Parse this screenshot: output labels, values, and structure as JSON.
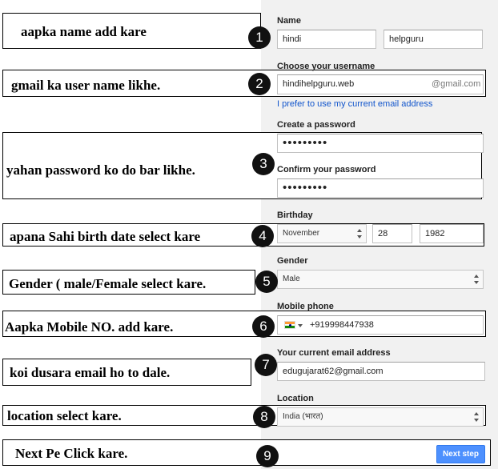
{
  "form": {
    "name_label": "Name",
    "first_name": "hindi",
    "last_name": "helpguru",
    "username_label": "Choose your username",
    "username_value": "hindihelpguru.web",
    "username_suffix": "@gmail.com",
    "use_current_email_link": "I prefer to use my current email address",
    "create_password_label": "Create a password",
    "password_mask": "•••••••••",
    "confirm_password_label": "Confirm your password",
    "confirm_password_mask": "•••••••••",
    "birthday_label": "Birthday",
    "birth_month": "November",
    "birth_day": "28",
    "birth_year": "1982",
    "gender_label": "Gender",
    "gender_value": "Male",
    "mobile_label": "Mobile phone",
    "mobile_value": "+919998447938",
    "current_email_label": "Your current email address",
    "current_email_value": "edugujarat62@gmail.com",
    "location_label": "Location",
    "location_value": "India (भारत)",
    "next_button": "Next step"
  },
  "notes": [
    {
      "number": "1",
      "text": "aapka name add kare"
    },
    {
      "number": "2",
      "text": "gmail ka user name likhe."
    },
    {
      "number": "3",
      "text": "yahan password ko do bar likhe."
    },
    {
      "number": "4",
      "text": "apana Sahi birth date select kare"
    },
    {
      "number": "5",
      "text": "Gender ( male/Female select kare."
    },
    {
      "number": "6",
      "text": "Aapka Mobile NO. add kare."
    },
    {
      "number": "7",
      "text": "koi dusara email ho to dale."
    },
    {
      "number": "8",
      "text": "location select kare."
    },
    {
      "number": "9",
      "text": "Next Pe Click kare."
    }
  ],
  "colors": {
    "link": "#1155cc",
    "primary_button": "#4d90fe",
    "form_background": "#f1f1f1"
  },
  "icons": {
    "select_arrows": "up-down-arrows-icon",
    "country_flag": "india-flag-icon"
  }
}
